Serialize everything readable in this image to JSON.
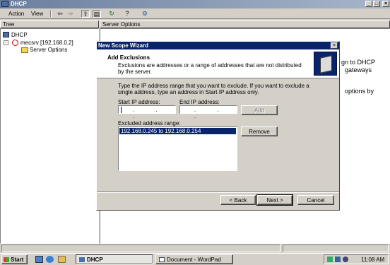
{
  "app": {
    "title": "DHCP",
    "controls": {
      "min": "_",
      "max": "□",
      "close": "×"
    }
  },
  "menu": {
    "action": "Action",
    "view": "View"
  },
  "toolbar": {
    "back": "⇦",
    "forward": "⇨",
    "up": "⇧",
    "show_tree": "▤",
    "refresh": "↻",
    "export": "⇪",
    "help": "?",
    "config": "⚙"
  },
  "tree": {
    "header": "Tree",
    "root": "DHCP",
    "server": "mecsrv [192.168.0.2]",
    "child": "Server Options"
  },
  "right": {
    "header": "Server Options",
    "text1": "gn to DHCP",
    "text2": "gateways",
    "text3": "options by"
  },
  "wizard": {
    "title": "New Scope Wizard",
    "close": "×",
    "heading": "Add Exclusions",
    "subheading": "Exclusions are addresses or a range of addresses that are not distributed by the server.",
    "instructions": "Type the IP address range that you want to exclude. If you want to exclude a single address, type an address in Start IP address only.",
    "start_label": "Start IP address:",
    "end_label": "End IP address:",
    "ip_dots": ". . .",
    "add_label": "Add",
    "excluded_label": "Excluded address range:",
    "excluded": [
      "192.168.0.245 to 192.168.0.254"
    ],
    "remove_label": "Remove",
    "back_label": "< Back",
    "next_label": "Next >",
    "cancel_label": "Cancel"
  },
  "taskbar": {
    "start": "Start",
    "tasks": [
      "DHCP",
      "Document - WordPad"
    ],
    "clock": "11:08 AM"
  },
  "colors": {
    "title_active": "#0a246a",
    "selection": "#0a246a",
    "face": "#d4d0c8"
  }
}
